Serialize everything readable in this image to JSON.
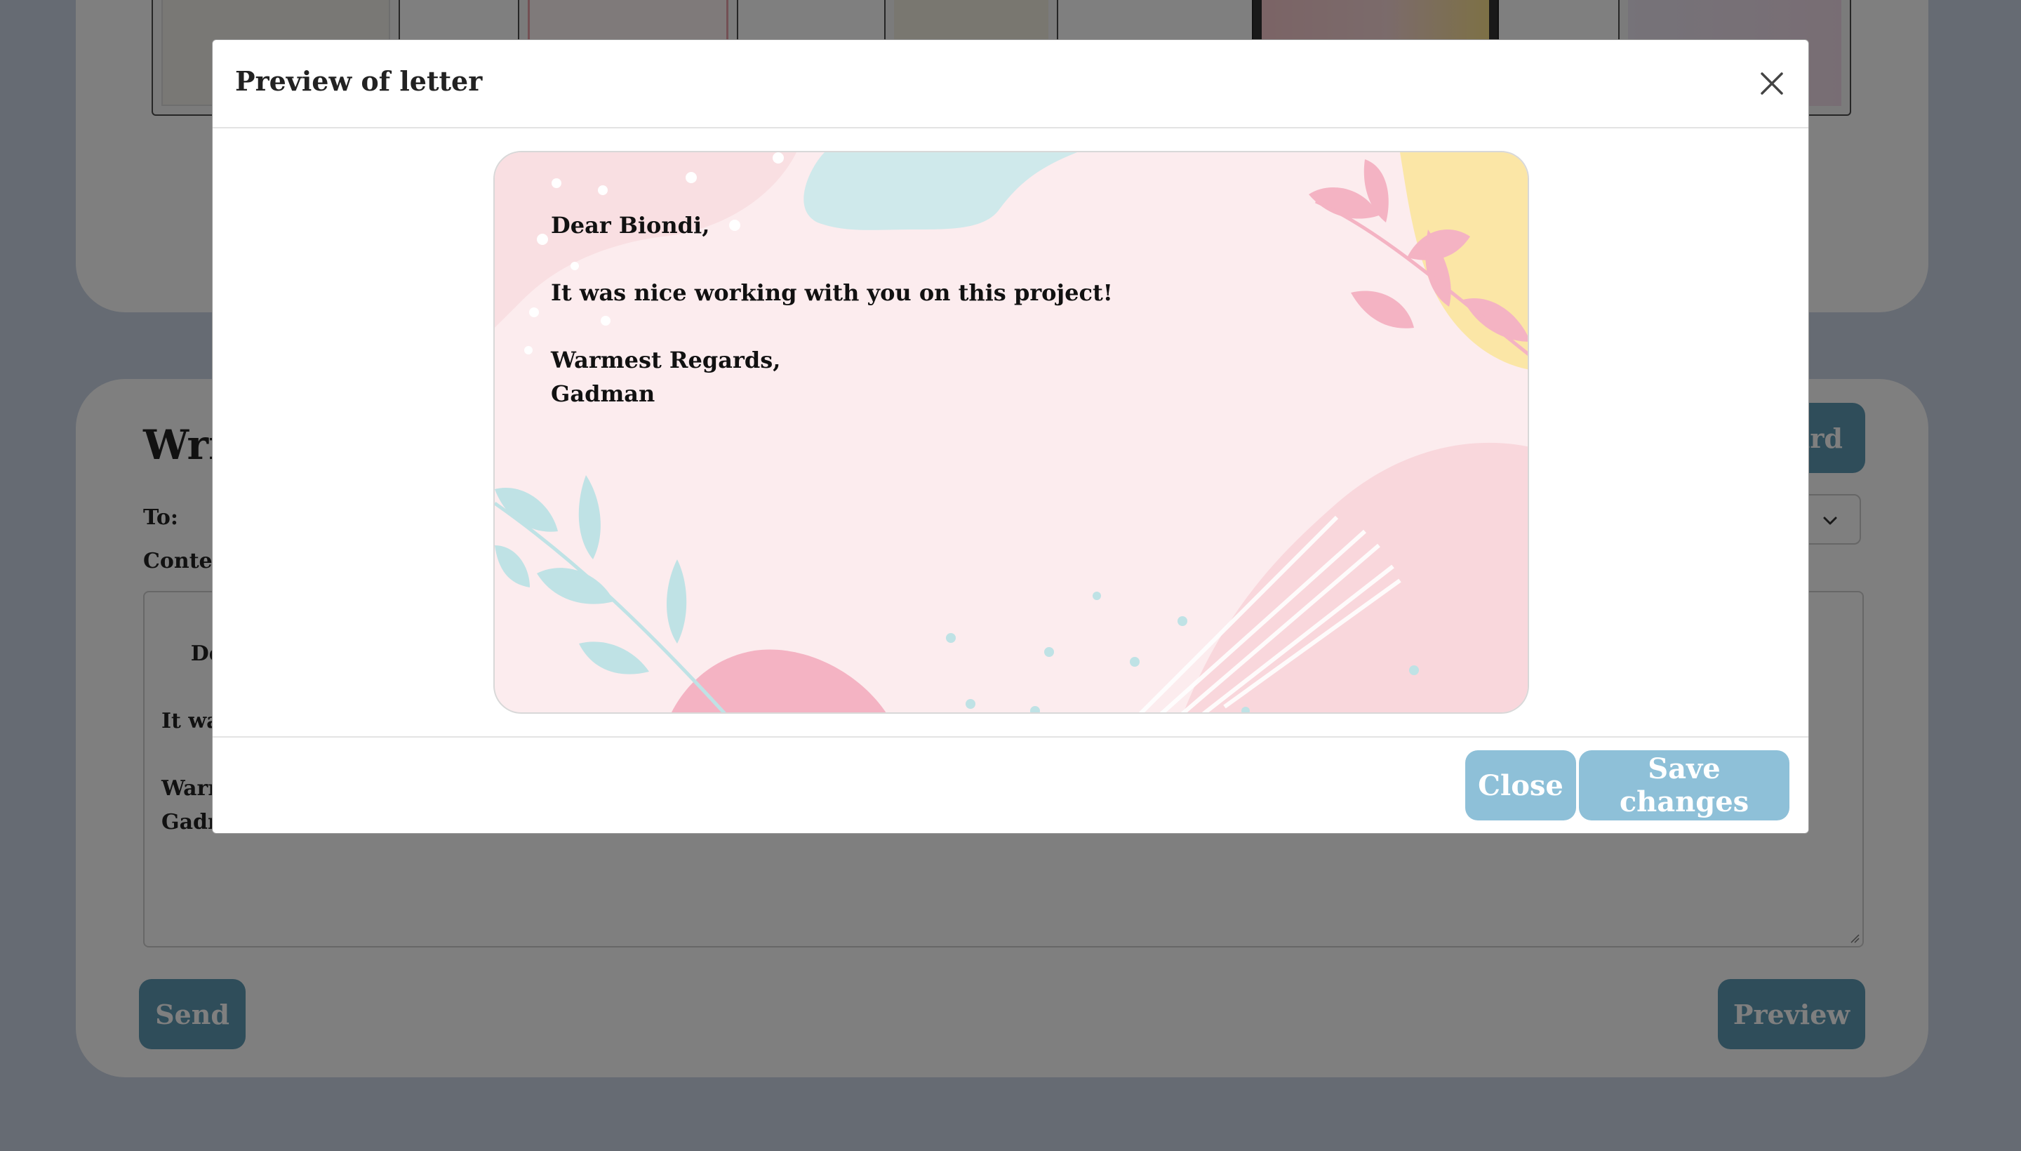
{
  "compose": {
    "title": "Wri",
    "to_label": "To:",
    "content_label": "Conten",
    "content_value": "Dear\n\nIt wa\n\nWarr\nGadm",
    "add_card_label": "ard",
    "send_label": "Send",
    "preview_label": "Preview"
  },
  "modal": {
    "title": "Preview of letter",
    "close_label": "Close",
    "save_label": "Save changes"
  },
  "letter": {
    "greeting": "Dear Biondi,",
    "body": "It was nice working with you on this project!",
    "closing": "Warmest Regards,",
    "signature": "Gadman"
  },
  "colors": {
    "button_primary": "#5e9ab4",
    "button_modal": "#8ec0d8",
    "letter_background": "#fcecee"
  },
  "icons": {
    "close": "close-icon",
    "select_caret": "chevron-down-icon",
    "resize": "resize-grip-icon"
  }
}
